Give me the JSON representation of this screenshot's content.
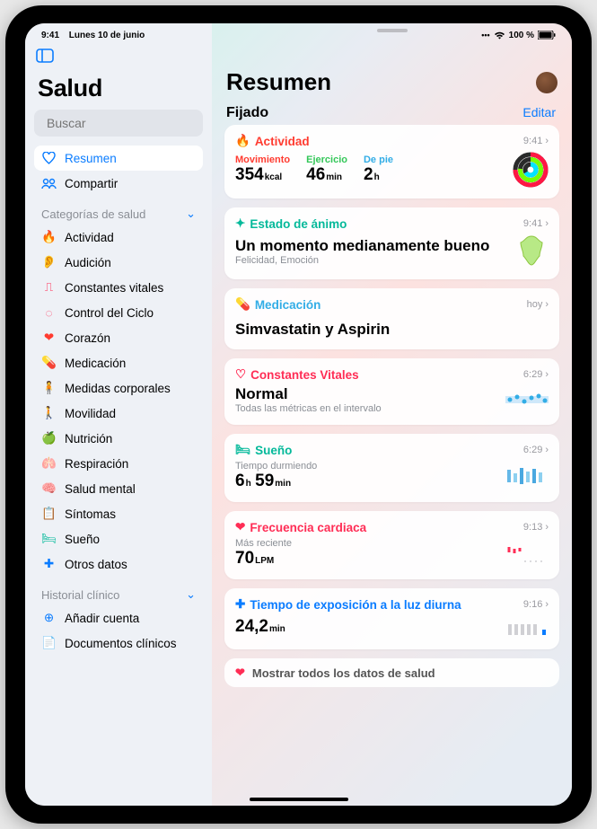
{
  "status": {
    "time": "9:41",
    "date": "Lunes 10 de junio",
    "battery": "100 %"
  },
  "sidebar": {
    "title": "Salud",
    "search_placeholder": "Buscar",
    "nav": [
      {
        "label": "Resumen",
        "icon": "heart-outline",
        "color": "#0a7cff",
        "active": true
      },
      {
        "label": "Compartir",
        "icon": "people",
        "color": "#0a7cff"
      }
    ],
    "section_categories": "Categorías de salud",
    "categories": [
      {
        "label": "Actividad",
        "icon": "flame",
        "color": "#ff3b30"
      },
      {
        "label": "Audición",
        "icon": "ear",
        "color": "#0a7cff"
      },
      {
        "label": "Constantes vitales",
        "icon": "ecg",
        "color": "#ff2d55"
      },
      {
        "label": "Control del Ciclo",
        "icon": "cycle",
        "color": "#ff2d55"
      },
      {
        "label": "Corazón",
        "icon": "heart",
        "color": "#ff3b30"
      },
      {
        "label": "Medicación",
        "icon": "pill",
        "color": "#32ade6"
      },
      {
        "label": "Medidas corporales",
        "icon": "body",
        "color": "#af52de"
      },
      {
        "label": "Movilidad",
        "icon": "mobility",
        "color": "#ff9500"
      },
      {
        "label": "Nutrición",
        "icon": "apple",
        "color": "#34c759"
      },
      {
        "label": "Respiración",
        "icon": "lungs",
        "color": "#32ade6"
      },
      {
        "label": "Salud mental",
        "icon": "brain",
        "color": "#04b99a"
      },
      {
        "label": "Síntomas",
        "icon": "symptoms",
        "color": "#5856d6"
      },
      {
        "label": "Sueño",
        "icon": "bed",
        "color": "#04b99a"
      },
      {
        "label": "Otros datos",
        "icon": "plus",
        "color": "#0a7cff"
      }
    ],
    "section_clinical": "Historial clínico",
    "clinical": [
      {
        "label": "Añadir cuenta",
        "icon": "plus-circle",
        "color": "#0a7cff"
      },
      {
        "label": "Documentos clínicos",
        "icon": "doc",
        "color": "#8e8e93"
      }
    ]
  },
  "main": {
    "title": "Resumen",
    "pinned": "Fijado",
    "edit": "Editar",
    "cards": {
      "activity": {
        "title": "Actividad",
        "time": "9:41",
        "move_label": "Movimiento",
        "move_val": "354",
        "move_unit": "kcal",
        "ex_label": "Ejercicio",
        "ex_val": "46",
        "ex_unit": "min",
        "stand_label": "De pie",
        "stand_val": "2",
        "stand_unit": "h"
      },
      "mood": {
        "title": "Estado de ánimo",
        "time": "9:41",
        "headline": "Un momento medianamente bueno",
        "sub": "Felicidad, Emoción"
      },
      "meds": {
        "title": "Medicación",
        "time": "hoy",
        "headline": "Simvastatin y Aspirin"
      },
      "vitals": {
        "title": "Constantes Vitales",
        "time": "6:29",
        "headline": "Normal",
        "sub": "Todas las métricas en el intervalo"
      },
      "sleep": {
        "title": "Sueño",
        "time": "6:29",
        "label": "Tiempo durmiendo",
        "h": "6",
        "h_unit": "h",
        "m": "59",
        "m_unit": "min"
      },
      "hr": {
        "title": "Frecuencia cardiaca",
        "time": "9:13",
        "label": "Más reciente",
        "val": "70",
        "unit": "LPM"
      },
      "daylight": {
        "title": "Tiempo de exposición a la luz diurna",
        "time": "9:16",
        "val": "24,2",
        "unit": "min"
      }
    },
    "show_all": "Mostrar todos los datos de salud"
  }
}
